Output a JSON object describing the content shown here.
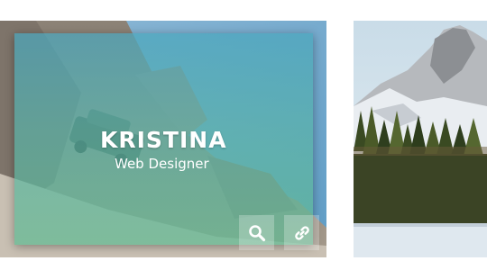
{
  "profile_card": {
    "name": "KRISTINA",
    "role": "Web Designer",
    "actions": {
      "zoom_icon": "search-icon",
      "link_icon": "link-icon"
    },
    "overlay_color": "#4aa6bd"
  },
  "second_card": {
    "image": "snowy mountain with pine forest"
  }
}
